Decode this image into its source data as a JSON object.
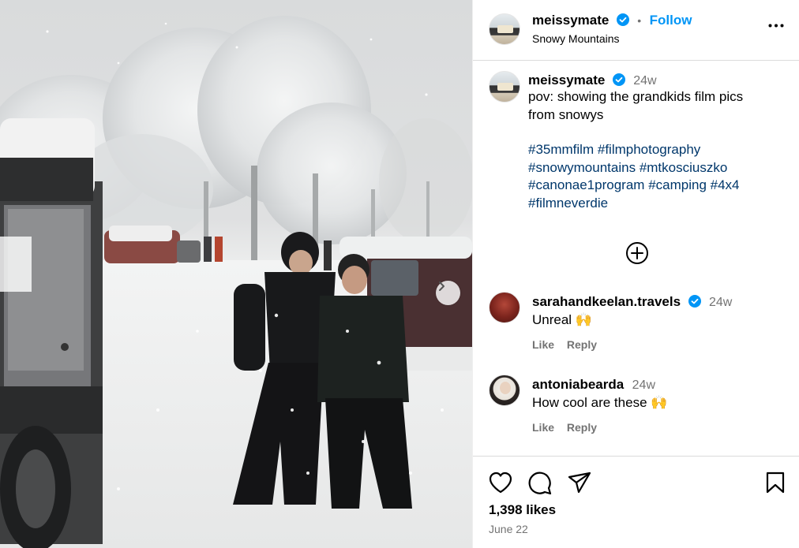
{
  "post": {
    "username": "meissymate",
    "follow_label": "Follow",
    "location": "Snowy Mountains",
    "caption_username": "meissymate",
    "caption_time": "24w",
    "caption_line1": "pov: showing the grandkids film pics",
    "caption_line2": "from snowys",
    "hashtags": {
      "line1": [
        "#35mmfilm",
        "#filmphotography"
      ],
      "line2": [
        "#snowymountains",
        "#mtkosciuszko"
      ],
      "line3": [
        "#canonae1program",
        "#camping",
        "#4x4"
      ],
      "line4": [
        "#filmneverdie"
      ]
    },
    "likes": "1,398 likes",
    "date": "June 22"
  },
  "comments": [
    {
      "username": "sarahandkeelan.travels",
      "verified": true,
      "time": "24w",
      "text": "Unreal",
      "emoji": "🙌",
      "like_label": "Like",
      "reply_label": "Reply"
    },
    {
      "username": "antoniabearda",
      "verified": false,
      "time": "24w",
      "text": "How cool are these",
      "emoji": "🙌",
      "like_label": "Like",
      "reply_label": "Reply"
    }
  ],
  "icons": {
    "verified": "verified-badge-icon",
    "more": "more-options-icon",
    "load_more": "plus-circle-icon",
    "like": "heart-icon",
    "comment": "comment-icon",
    "share": "share-icon",
    "save": "bookmark-icon",
    "next": "chevron-right-icon"
  },
  "colors": {
    "verified": "#0095f6",
    "follow": "#0095f6",
    "hashtag": "#3f51d6",
    "secondary": "#737373"
  }
}
